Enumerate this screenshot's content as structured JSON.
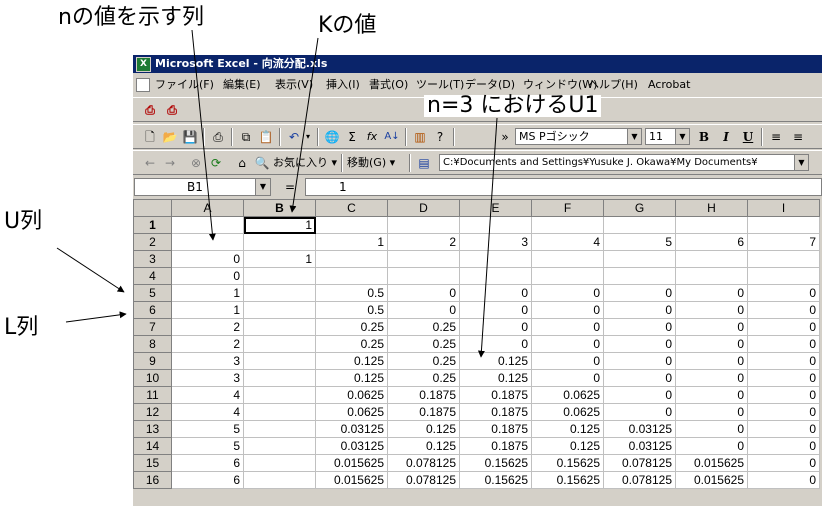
{
  "annotations": {
    "n_column": "nの値を示す列",
    "k_value": "Kの値",
    "n3_u1": "n=3 におけるU1",
    "u_column": "U列",
    "l_column": "L列"
  },
  "window": {
    "title": "Microsoft Excel - 向流分配.xls",
    "app_icon": "excel-icon"
  },
  "menu": [
    "ファイル(F)",
    "編集(E)",
    "表示(V)",
    "挿入(I)",
    "書式(O)",
    "ツール(T)",
    "データ(D)",
    "ウィンドウ(W)",
    "ヘルプ(H)",
    "Acrobat"
  ],
  "toolbar": {
    "font_name": "MS Pゴシック",
    "font_size": "11",
    "bold": "B",
    "italic": "I",
    "underline": "U",
    "more": "»",
    "sum": "Σ",
    "fx": "fx",
    "sort": "A↓",
    "favorites": "お気に入り ▾",
    "go": "移動(G) ▾",
    "address": "C:¥Documents and Settings¥Yusuke J. Okawa¥My Documents¥"
  },
  "formula_bar": {
    "name_box": "B1",
    "equals": "=",
    "value": "1"
  },
  "sheet": {
    "columns": [
      "A",
      "B",
      "C",
      "D",
      "E",
      "F",
      "G",
      "H",
      "I"
    ],
    "rows": [
      {
        "n": "1",
        "cells": [
          "",
          "1",
          "",
          "",
          "",
          "",
          "",
          "",
          ""
        ]
      },
      {
        "n": "2",
        "cells": [
          "",
          "",
          "1",
          "2",
          "3",
          "4",
          "5",
          "6",
          "7"
        ]
      },
      {
        "n": "3",
        "cells": [
          "0",
          "1",
          "",
          "",
          "",
          "",
          "",
          "",
          ""
        ]
      },
      {
        "n": "4",
        "cells": [
          "0",
          "",
          "",
          "",
          "",
          "",
          "",
          "",
          ""
        ]
      },
      {
        "n": "5",
        "cells": [
          "1",
          "",
          "0.5",
          "0",
          "0",
          "0",
          "0",
          "0",
          "0"
        ]
      },
      {
        "n": "6",
        "cells": [
          "1",
          "",
          "0.5",
          "0",
          "0",
          "0",
          "0",
          "0",
          "0"
        ]
      },
      {
        "n": "7",
        "cells": [
          "2",
          "",
          "0.25",
          "0.25",
          "0",
          "0",
          "0",
          "0",
          "0"
        ]
      },
      {
        "n": "8",
        "cells": [
          "2",
          "",
          "0.25",
          "0.25",
          "0",
          "0",
          "0",
          "0",
          "0"
        ]
      },
      {
        "n": "9",
        "cells": [
          "3",
          "",
          "0.125",
          "0.25",
          "0.125",
          "0",
          "0",
          "0",
          "0"
        ]
      },
      {
        "n": "10",
        "cells": [
          "3",
          "",
          "0.125",
          "0.25",
          "0.125",
          "0",
          "0",
          "0",
          "0"
        ]
      },
      {
        "n": "11",
        "cells": [
          "4",
          "",
          "0.0625",
          "0.1875",
          "0.1875",
          "0.0625",
          "0",
          "0",
          "0"
        ]
      },
      {
        "n": "12",
        "cells": [
          "4",
          "",
          "0.0625",
          "0.1875",
          "0.1875",
          "0.0625",
          "0",
          "0",
          "0"
        ]
      },
      {
        "n": "13",
        "cells": [
          "5",
          "",
          "0.03125",
          "0.125",
          "0.1875",
          "0.125",
          "0.03125",
          "0",
          "0"
        ]
      },
      {
        "n": "14",
        "cells": [
          "5",
          "",
          "0.03125",
          "0.125",
          "0.1875",
          "0.125",
          "0.03125",
          "0",
          "0"
        ]
      },
      {
        "n": "15",
        "cells": [
          "6",
          "",
          "0.015625",
          "0.078125",
          "0.15625",
          "0.15625",
          "0.078125",
          "0.015625",
          "0"
        ]
      },
      {
        "n": "16",
        "cells": [
          "6",
          "",
          "0.015625",
          "0.078125",
          "0.15625",
          "0.15625",
          "0.078125",
          "0.015625",
          "0"
        ]
      }
    ]
  }
}
